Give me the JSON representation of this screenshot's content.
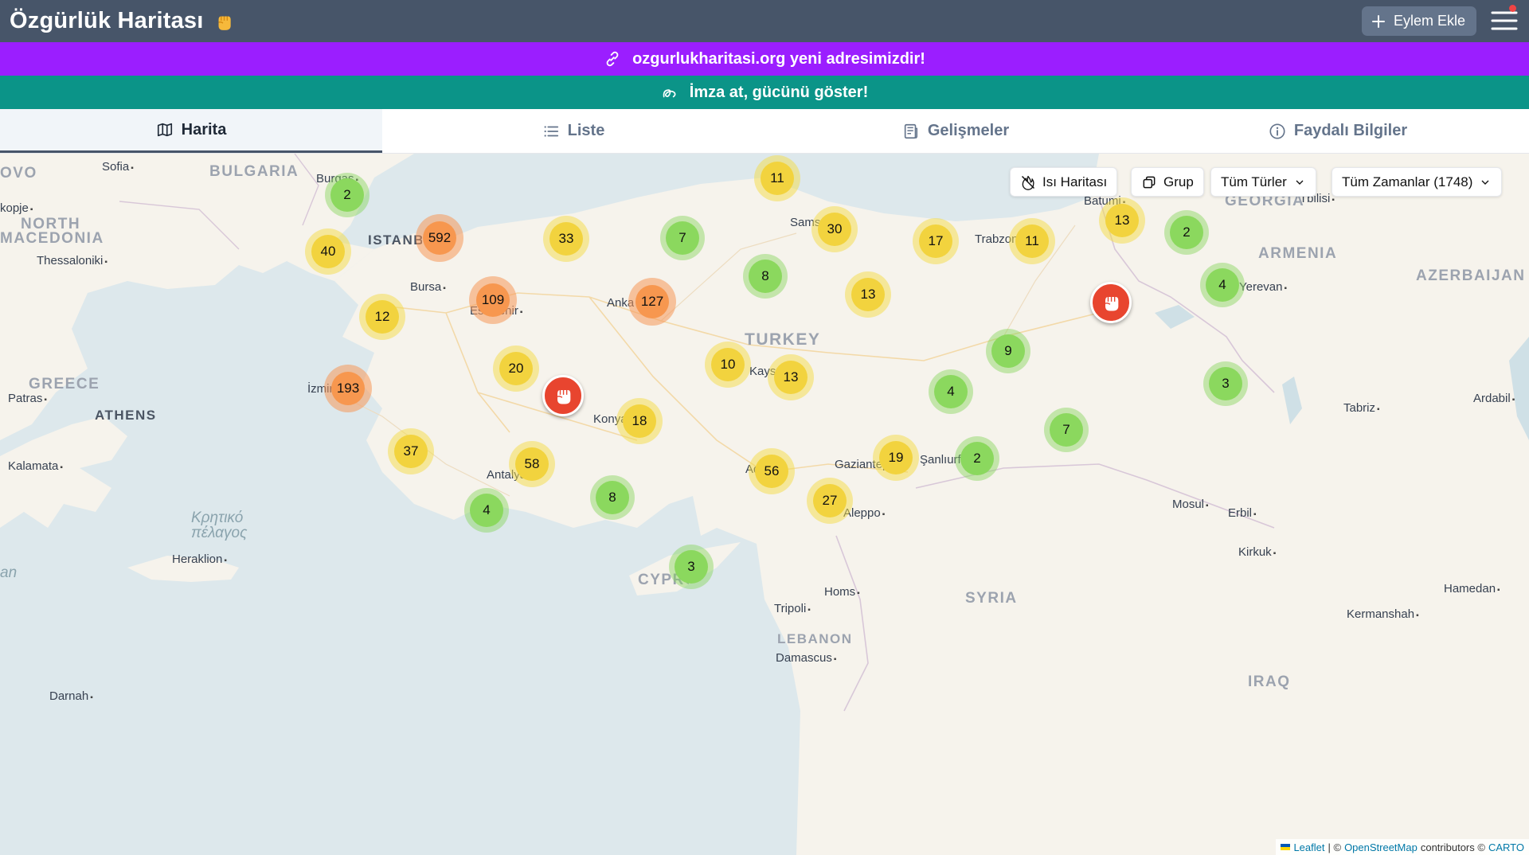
{
  "header": {
    "title": "Özgürlük Haritası",
    "add_button_label": "Eylem Ekle"
  },
  "banners": {
    "address_notice": "ozgurlukharitasi.org yeni adresimizdir!",
    "petition_notice": "İmza at, gücünü göster!"
  },
  "tabs": [
    {
      "label": "Harita",
      "icon": "map-icon",
      "active": true
    },
    {
      "label": "Liste",
      "icon": "list-icon",
      "active": false
    },
    {
      "label": "Gelişmeler",
      "icon": "news-icon",
      "active": false,
      "notification": true
    },
    {
      "label": "Faydalı Bilgiler",
      "icon": "info-icon",
      "active": false
    }
  ],
  "map_controls": {
    "heatmap_label": "Isı Haritası",
    "group_label": "Grup",
    "type_filter": "Tüm Türler",
    "time_filter": "Tüm Zamanlar (1748)"
  },
  "map_labels": {
    "countries": [
      "BULGARIA",
      "NORTH",
      "MACEDONIA",
      "GREECE",
      "TURKEY",
      "GEORGIA",
      "ARMENIA",
      "AZERBAIJAN",
      "SYRIA",
      "LEBANON",
      "IRAQ",
      "OVO",
      "CYPRUS"
    ],
    "cities": [
      "Sofia",
      "Burgas",
      "kopje",
      "Thessaloniki",
      "Patras",
      "ATHENS",
      "Kalamata",
      "Heraklion",
      "Darnah",
      "ISTANBUL",
      "Bursa",
      "Eskisehir",
      "Ankara",
      "İzmir",
      "Konya",
      "Antalya",
      "Kayseri",
      "Samsun",
      "Trabzon",
      "Batumi",
      "Tbilisi",
      "Yerevan",
      "Gaziantep",
      "Şanlıurfa",
      "Adana",
      "Aleppo",
      "Homs",
      "Tripoli",
      "Damascus",
      "Mosul",
      "Erbil",
      "Kirkuk",
      "Tabriz",
      "Ardabil",
      "Hamedan",
      "Kermanshah"
    ],
    "sea": [
      "Κρητικό",
      "πέλαγος"
    ],
    "edge_fragments": [
      "an"
    ]
  },
  "clusters": [
    {
      "count": "2",
      "level": "green"
    },
    {
      "count": "40",
      "level": "yellow"
    },
    {
      "count": "592",
      "level": "orange"
    },
    {
      "count": "33",
      "level": "yellow"
    },
    {
      "count": "11",
      "level": "yellow"
    },
    {
      "count": "7",
      "level": "green"
    },
    {
      "count": "30",
      "level": "yellow"
    },
    {
      "count": "17",
      "level": "yellow"
    },
    {
      "count": "11",
      "level": "yellow"
    },
    {
      "count": "13",
      "level": "yellow"
    },
    {
      "count": "2",
      "level": "green"
    },
    {
      "count": "12",
      "level": "yellow"
    },
    {
      "count": "109",
      "level": "orange"
    },
    {
      "count": "127",
      "level": "orange"
    },
    {
      "count": "8",
      "level": "green"
    },
    {
      "count": "13",
      "level": "yellow"
    },
    {
      "count": "4",
      "level": "green"
    },
    {
      "count": "193",
      "level": "orange"
    },
    {
      "count": "20",
      "level": "yellow"
    },
    {
      "count": "10",
      "level": "yellow"
    },
    {
      "count": "13",
      "level": "yellow"
    },
    {
      "count": "9",
      "level": "green"
    },
    {
      "count": "4",
      "level": "green"
    },
    {
      "count": "3",
      "level": "green"
    },
    {
      "count": "18",
      "level": "yellow"
    },
    {
      "count": "7",
      "level": "green"
    },
    {
      "count": "37",
      "level": "yellow"
    },
    {
      "count": "58",
      "level": "yellow"
    },
    {
      "count": "56",
      "level": "yellow"
    },
    {
      "count": "19",
      "level": "yellow"
    },
    {
      "count": "2",
      "level": "green"
    },
    {
      "count": "8",
      "level": "green"
    },
    {
      "count": "4",
      "level": "green"
    },
    {
      "count": "27",
      "level": "yellow"
    },
    {
      "count": "3",
      "level": "green"
    }
  ],
  "attribution": {
    "leaflet": "Leaflet",
    "sep1": "| ©",
    "osm": "OpenStreetMap",
    "mid": "contributors ©",
    "carto": "CARTO"
  },
  "colors": {
    "header": "#475569",
    "banner_purple": "#9b1eff",
    "banner_teal": "#0b9488",
    "pin": "#e8452f"
  }
}
